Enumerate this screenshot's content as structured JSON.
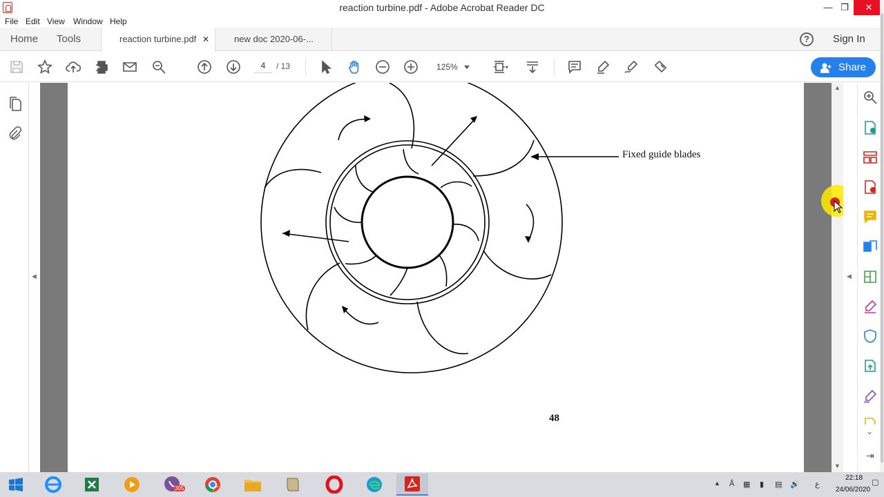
{
  "window": {
    "title": "reaction turbine.pdf - Adobe Acrobat Reader DC"
  },
  "menu": {
    "items": [
      "File",
      "Edit",
      "View",
      "Window",
      "Help"
    ]
  },
  "tabs": {
    "home": "Home",
    "tools": "Tools",
    "active_doc": "reaction turbine.pdf",
    "other_doc": "new doc 2020-06-..."
  },
  "header": {
    "sign_in": "Sign In"
  },
  "toolbar": {
    "page_current": "4",
    "page_total": "/ 13",
    "zoom": "125%",
    "share_label": "Share"
  },
  "document": {
    "label_fixed_guide_blades": "Fixed guide blades",
    "page_number": "48"
  },
  "taskbar": {
    "viber_badge": "305",
    "time": "22:18",
    "date": "24/06/2020",
    "lang": "ع"
  },
  "colors": {
    "accent": "#2680eb",
    "close_red": "#e81123",
    "acrobat_red": "#d4261c"
  }
}
